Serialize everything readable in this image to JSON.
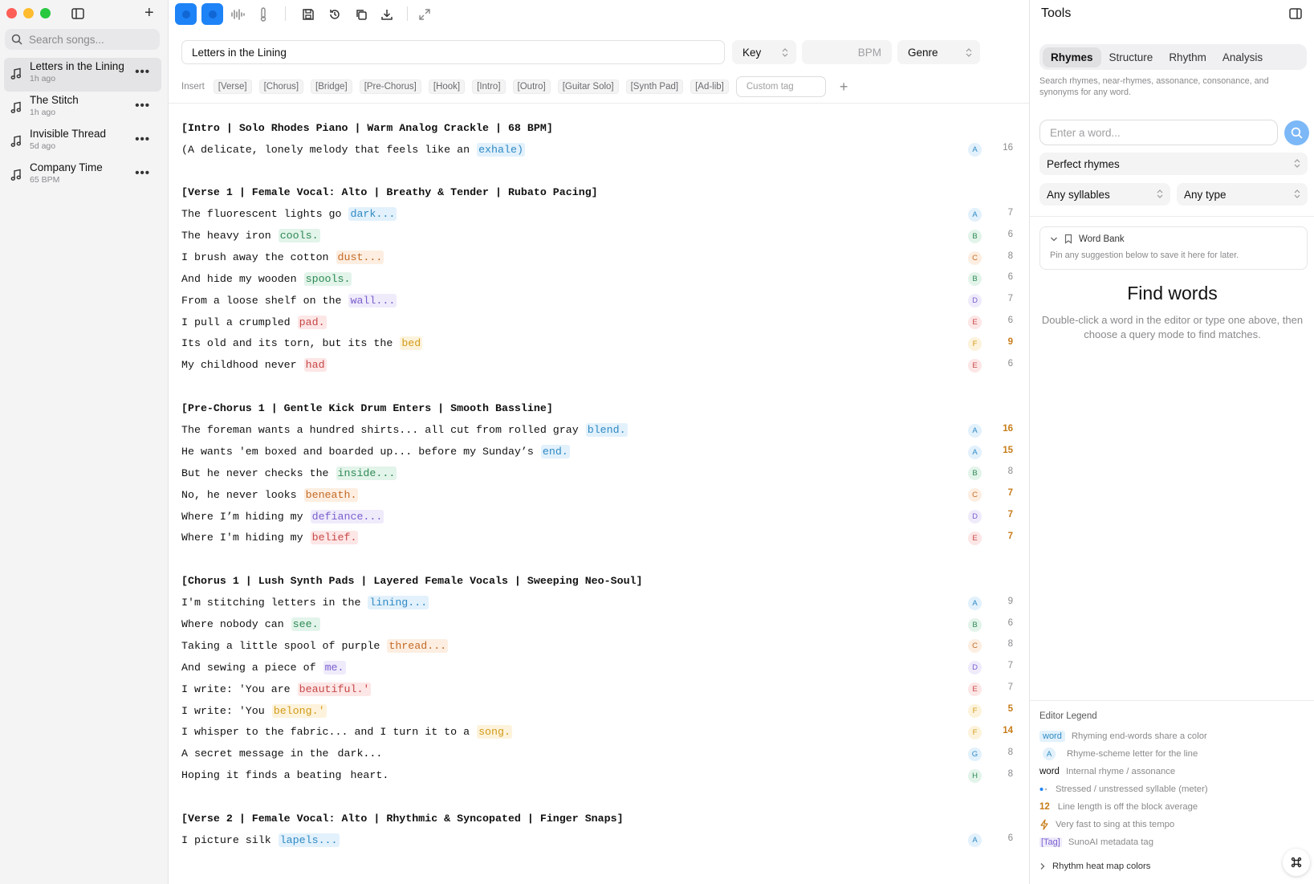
{
  "sidebar": {
    "search_placeholder": "Search songs...",
    "songs": [
      {
        "title": "Letters in the Lining",
        "meta": "1h ago"
      },
      {
        "title": "The Stitch",
        "meta": "1h ago"
      },
      {
        "title": "Invisible Thread",
        "meta": "5d ago"
      },
      {
        "title": "Company Time",
        "meta": "65 BPM"
      }
    ],
    "more_label": "•••"
  },
  "editor": {
    "title_value": "Letters in the Lining",
    "key_label": "Key",
    "bpm_placeholder": "BPM",
    "genre_label": "Genre",
    "insert_label": "Insert",
    "chips": [
      "[Verse]",
      "[Chorus]",
      "[Bridge]",
      "[Pre-Chorus]",
      "[Hook]",
      "[Intro]",
      "[Outro]",
      "[Guitar Solo]",
      "[Synth Pad]",
      "[Ad-lib]"
    ],
    "custom_tag_placeholder": "Custom tag",
    "lines": [
      {
        "text": "[Intro | Solo Rhodes Piano | Warm Analog Crackle | 68 BPM]",
        "tag": true
      },
      {
        "text": "(A delicate, lonely melody that feels like an ",
        "end": "exhale)",
        "letter": "A",
        "count": "16"
      },
      {
        "text": "[Verse 1 | Female Vocal: Alto | Breathy & Tender | Rubato Pacing]",
        "tag": true
      },
      {
        "text": "The fluorescent lights go ",
        "end": "dark...",
        "letter": "A",
        "count": "7"
      },
      {
        "text": "The heavy iron ",
        "end": "cools.",
        "letter": "B",
        "count": "6"
      },
      {
        "text": "I brush away the cotton ",
        "end": "dust...",
        "letter": "C",
        "count": "8"
      },
      {
        "text": "And hide my wooden ",
        "end": "spools.",
        "letter": "B",
        "count": "6"
      },
      {
        "text": "From a loose shelf on the ",
        "end": "wall...",
        "letter": "D",
        "count": "7"
      },
      {
        "text": "I pull a crumpled ",
        "end": "pad.",
        "letter": "E",
        "count": "6"
      },
      {
        "text": "Its old and its torn, but its the ",
        "end": "bed",
        "letter": "F",
        "count": "9",
        "warn": true
      },
      {
        "text": "My childhood never ",
        "end": "had",
        "letter": "E",
        "count": "6"
      },
      {
        "text": "[Pre-Chorus 1 | Gentle Kick Drum Enters | Smooth Bassline]",
        "tag": true
      },
      {
        "text": "The foreman wants a hundred shirts... all cut from rolled gray ",
        "end": "blend.",
        "letter": "A",
        "count": "16",
        "warn": true
      },
      {
        "text": "He wants 'em boxed and boarded up... before my Sunday’s ",
        "end": "end.",
        "letter": "A",
        "count": "15",
        "warn": true
      },
      {
        "text": "But he never checks the ",
        "end": "inside...",
        "letter": "B",
        "count": "8"
      },
      {
        "text": "No, he never looks ",
        "end": "beneath.",
        "letter": "C",
        "count": "7",
        "warn": true
      },
      {
        "text": "Where I’m hiding my ",
        "end": "defiance...",
        "letter": "D",
        "count": "7",
        "warn": true
      },
      {
        "text": "Where I'm hiding my ",
        "end": "belief.",
        "letter": "E",
        "count": "7",
        "warn": true
      },
      {
        "text": "[Chorus 1 | Lush Synth Pads | Layered Female Vocals | Sweeping Neo-Soul]",
        "tag": true
      },
      {
        "text": "I'm stitching letters in the ",
        "end": "lining...",
        "letter": "A",
        "count": "9"
      },
      {
        "text": "Where nobody can ",
        "end": "see.",
        "letter": "B",
        "count": "6"
      },
      {
        "text": "Taking a little spool of purple ",
        "end": "thread...",
        "letter": "C",
        "count": "8"
      },
      {
        "text": "And sewing a piece of ",
        "end": "me.",
        "letter": "D",
        "count": "7"
      },
      {
        "text": "I write: 'You are ",
        "end": "beautiful.'",
        "letter": "E",
        "count": "7"
      },
      {
        "text": "I write: 'You ",
        "end": "belong.'",
        "letter": "F",
        "count": "5",
        "warn": true
      },
      {
        "text": "I whisper to the fabric... and I turn it to a ",
        "end": "song.",
        "letter": "F",
        "count": "14",
        "warn": true
      },
      {
        "text": "A secret message in the ",
        "end": "dark...",
        "letter": "G",
        "count": "8"
      },
      {
        "text": "Hoping it finds a beating ",
        "end": "heart.",
        "letter": "H",
        "count": "8"
      },
      {
        "text": "[Verse 2 | Female Vocal: Alto | Rhythmic & Syncopated | Finger Snaps]",
        "tag": true
      },
      {
        "text": "I picture silk ",
        "end": "lapels...",
        "letter": "A",
        "count": "6"
      }
    ]
  },
  "tools": {
    "title": "Tools",
    "tabs": [
      "Rhymes",
      "Structure",
      "Rhythm",
      "Analysis"
    ],
    "description": "Search rhymes, near-rhymes, assonance, consonance, and synonyms for any word.",
    "word_placeholder": "Enter a word...",
    "mode": "Perfect rhymes",
    "syllables": "Any syllables",
    "type": "Any type",
    "word_bank": {
      "title": "Word Bank",
      "description": "Pin any suggestion below to save it here for later."
    },
    "find_title": "Find words",
    "find_description": "Double-click a word in the editor or type one above, then choose a query mode to find matches.",
    "legend": {
      "title": "Editor Legend",
      "word_sample": "word",
      "word_desc": "Rhyming end-words share a color",
      "letter_sample": "A",
      "letter_desc": "Rhyme-scheme letter for the line",
      "internal_sample": "word",
      "internal_desc": "Internal rhyme / assonance",
      "stress_desc": "Stressed / unstressed syllable (meter)",
      "length_sample": "12",
      "length_desc": "Line length is off the block average",
      "fast_desc": "Very fast to sing at this tempo",
      "tag_sample": "[Tag]",
      "tag_desc": "SunoAI metadata tag"
    },
    "heat_label": "Rhythm heat map colors"
  },
  "colors": {
    "accent": "#1e83f7",
    "warn": "#c77c19"
  }
}
